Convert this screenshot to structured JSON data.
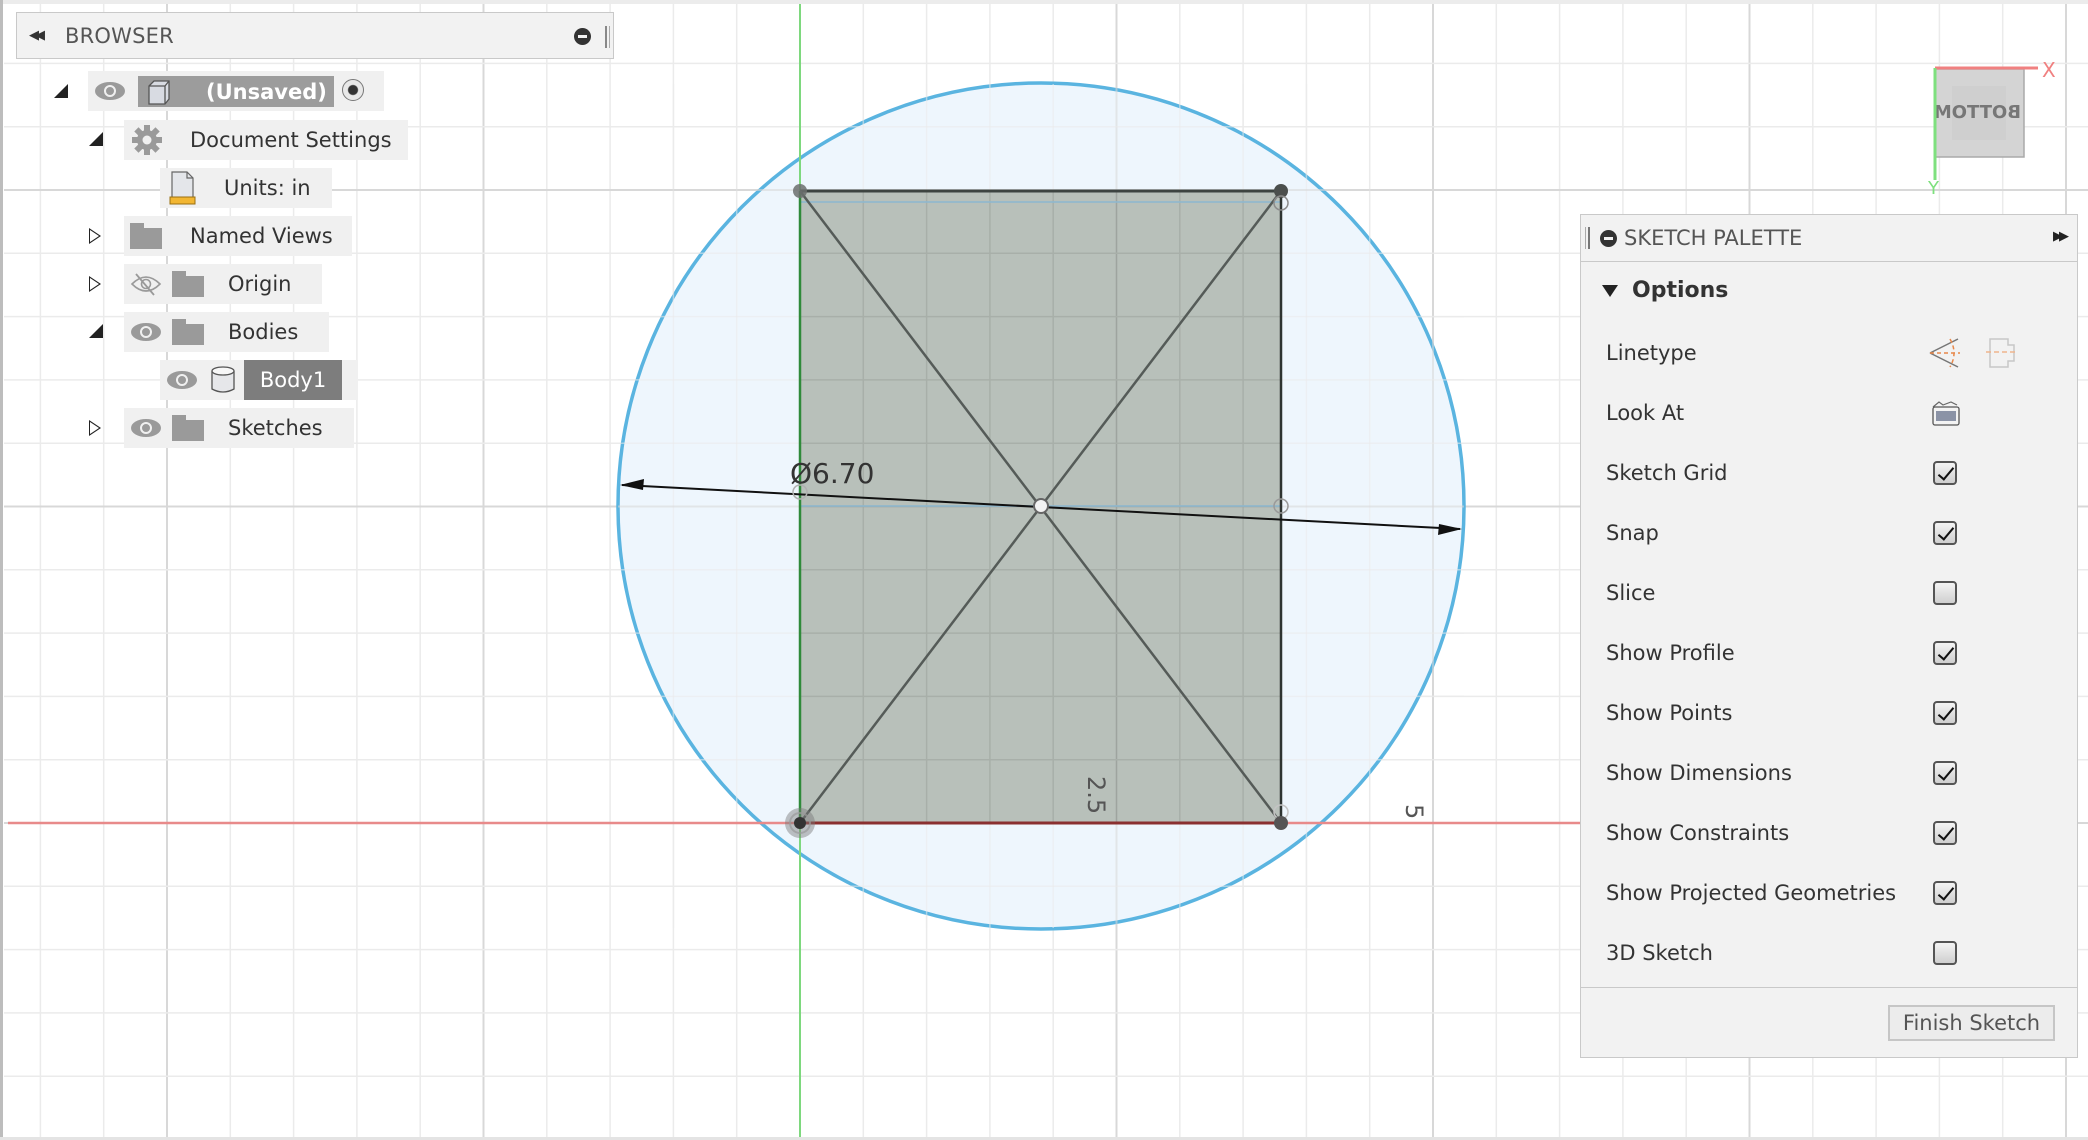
{
  "browser": {
    "title": "BROWSER",
    "tree": [
      {
        "label": "(Unsaved)",
        "expanded": true,
        "visible": true,
        "icon": "component-icon",
        "active": true
      },
      {
        "label": "Document Settings",
        "expanded": true,
        "icon": "gear-icon"
      },
      {
        "label": "Units: in",
        "icon": "units-document-icon"
      },
      {
        "label": "Named Views",
        "expanded": false,
        "icon": "folder-icon"
      },
      {
        "label": "Origin",
        "expanded": false,
        "visible": false,
        "icon": "folder-icon"
      },
      {
        "label": "Bodies",
        "expanded": true,
        "visible": true,
        "icon": "folder-icon"
      },
      {
        "label": "Body1",
        "visible": true,
        "icon": "body-icon",
        "selected": true
      },
      {
        "label": "Sketches",
        "expanded": false,
        "visible": true,
        "icon": "folder-icon"
      }
    ]
  },
  "viewcube": {
    "face_label": "BOTTOM",
    "x_label": "X",
    "y_label": "Y"
  },
  "sketch": {
    "diameter_dimension": "Ø6.70",
    "vertical_label": "2.5",
    "axis_label": "5",
    "units": "in"
  },
  "palette": {
    "title": "SKETCH PALETTE",
    "section": "Options",
    "rows": [
      {
        "label": "Linetype",
        "type": "icons"
      },
      {
        "label": "Look At",
        "type": "icon"
      },
      {
        "label": "Sketch Grid",
        "type": "checkbox",
        "checked": true
      },
      {
        "label": "Snap",
        "type": "checkbox",
        "checked": true
      },
      {
        "label": "Slice",
        "type": "checkbox",
        "checked": false
      },
      {
        "label": "Show Profile",
        "type": "checkbox",
        "checked": true
      },
      {
        "label": "Show Points",
        "type": "checkbox",
        "checked": true
      },
      {
        "label": "Show Dimensions",
        "type": "checkbox",
        "checked": true
      },
      {
        "label": "Show Constraints",
        "type": "checkbox",
        "checked": true
      },
      {
        "label": "Show Projected Geometries",
        "type": "checkbox",
        "checked": true
      },
      {
        "label": "3D Sketch",
        "type": "checkbox",
        "checked": false
      }
    ],
    "finish_label": "Finish Sketch"
  },
  "colors": {
    "x_axis": "#e88a8a",
    "y_axis": "#7ed87e",
    "circle": "#5ab4e0",
    "circle_fill": "#eef6fd",
    "profile_fill": "#b4bdb6",
    "panel_bg": "#f2f2f2",
    "selected": "#7d7d7d"
  }
}
